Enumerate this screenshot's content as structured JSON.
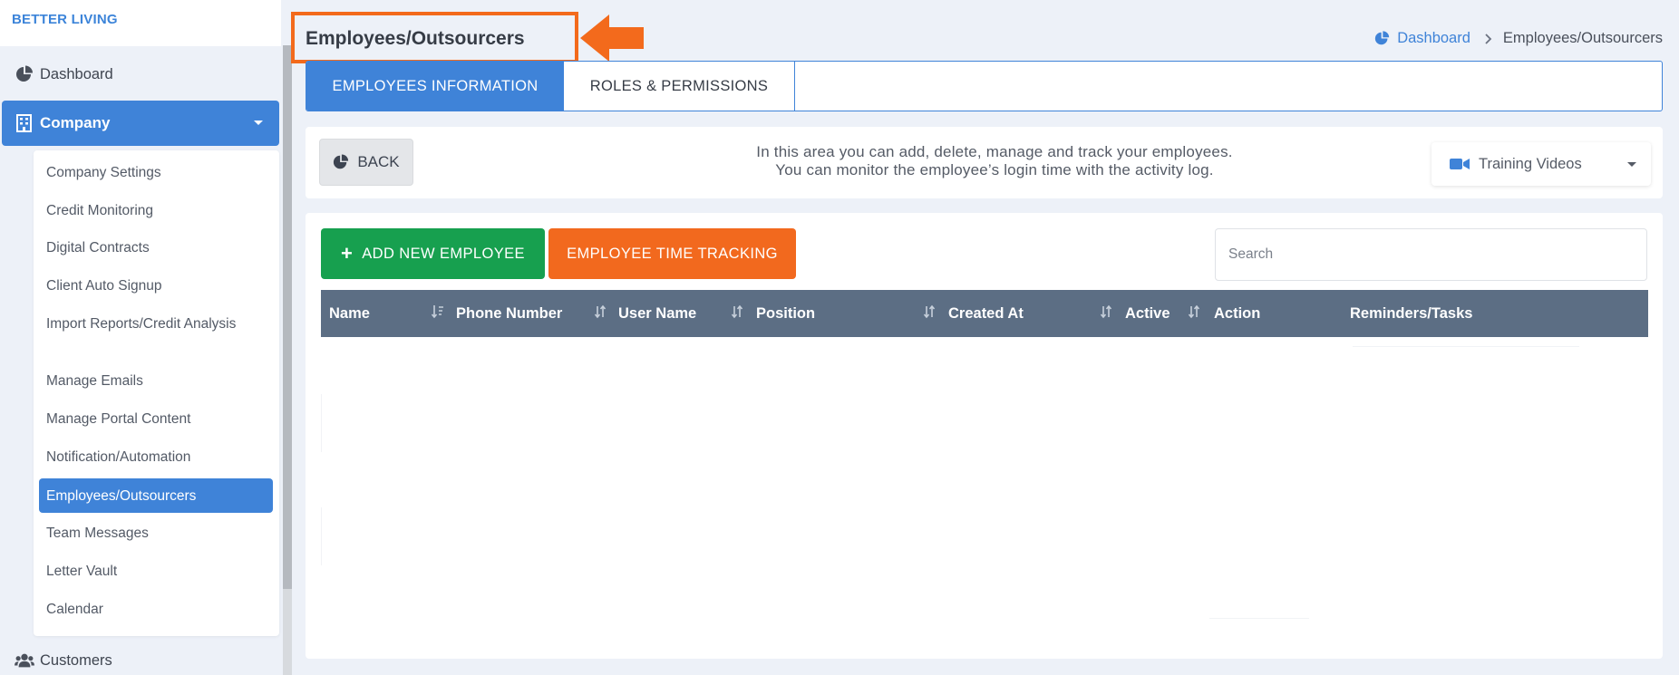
{
  "sidebar": {
    "brand": "BETTER LIVING",
    "dashboard": "Dashboard",
    "company": "Company",
    "submenu": [
      "Company Settings",
      "Credit Monitoring",
      "Digital Contracts",
      "Client Auto Signup",
      "Import Reports/Credit Analysis",
      "Manage Emails",
      "Manage Portal Content",
      "Notification/Automation",
      "Employees/Outsourcers",
      "Team Messages",
      "Letter Vault",
      "Calendar"
    ],
    "active_item": "Employees/Outsourcers",
    "customers": "Customers"
  },
  "header": {
    "title": "Employees/Outsourcers",
    "breadcrumb_home": "Dashboard",
    "breadcrumb_current": "Employees/Outsourcers",
    "highlight_color": "#f36a1c"
  },
  "tabs": [
    {
      "label": "EMPLOYEES INFORMATION",
      "active": true
    },
    {
      "label": "ROLES & PERMISSIONS",
      "active": false
    }
  ],
  "info": {
    "back_label": "BACK",
    "line1": "In this area you can add, delete, manage and track your employees.",
    "line2": "You can monitor the employee’s login time with the activity log.",
    "training_label": "Training Videos"
  },
  "actions": {
    "add_employee": "ADD NEW EMPLOYEE",
    "time_tracking": "EMPLOYEE TIME TRACKING",
    "search_placeholder": "Search"
  },
  "table": {
    "columns": [
      "Name",
      "Phone Number",
      "User Name",
      "Position",
      "Created At",
      "Active",
      "Action",
      "Reminders/Tasks"
    ]
  },
  "colors": {
    "primary": "#3f83d8",
    "success": "#17a04f",
    "warning": "#f2691e",
    "table_header": "#5c6e84"
  }
}
